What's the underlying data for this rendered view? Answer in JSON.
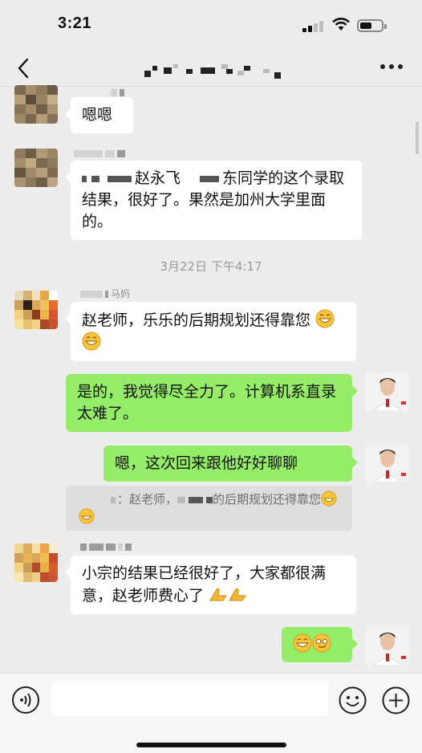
{
  "status_bar": {
    "time": "3:21"
  },
  "chat": {
    "colors": {
      "background": "#ededed",
      "my_bubble": "#95ec69",
      "their_bubble": "#ffffff"
    },
    "messages": [
      {
        "side": "left",
        "text": "嗯嗯"
      },
      {
        "side": "left",
        "text_pre": "赵永飞",
        "text_mid": "东同学的这个录取结果，很好了。果然是加州大学里面的。"
      },
      {
        "side": "left",
        "sender": "马妈",
        "text": "赵老师，乐乐的后期规划还得靠您"
      },
      {
        "side": "right",
        "text": "是的，我觉得尽全力了。计算机系直录太难了。"
      },
      {
        "side": "right",
        "text": "嗯，这次回来跟他好好聊聊"
      },
      {
        "side": "left",
        "text": "小宗的结果已经很好了，大家都很满意，赵老师费心了"
      }
    ],
    "timestamp": "3月22日 下午4:17",
    "quote": {
      "prefix": "：赵老师，",
      "suffix": "的后期规划还得靠您"
    },
    "emoji_names": [
      "grinning-emoji",
      "smirk-emoji",
      "pray-emoji"
    ]
  },
  "input": {
    "placeholder": ""
  },
  "icons": [
    "back-icon",
    "more-icon",
    "voice-icon",
    "emoji-icon",
    "plus-icon"
  ]
}
